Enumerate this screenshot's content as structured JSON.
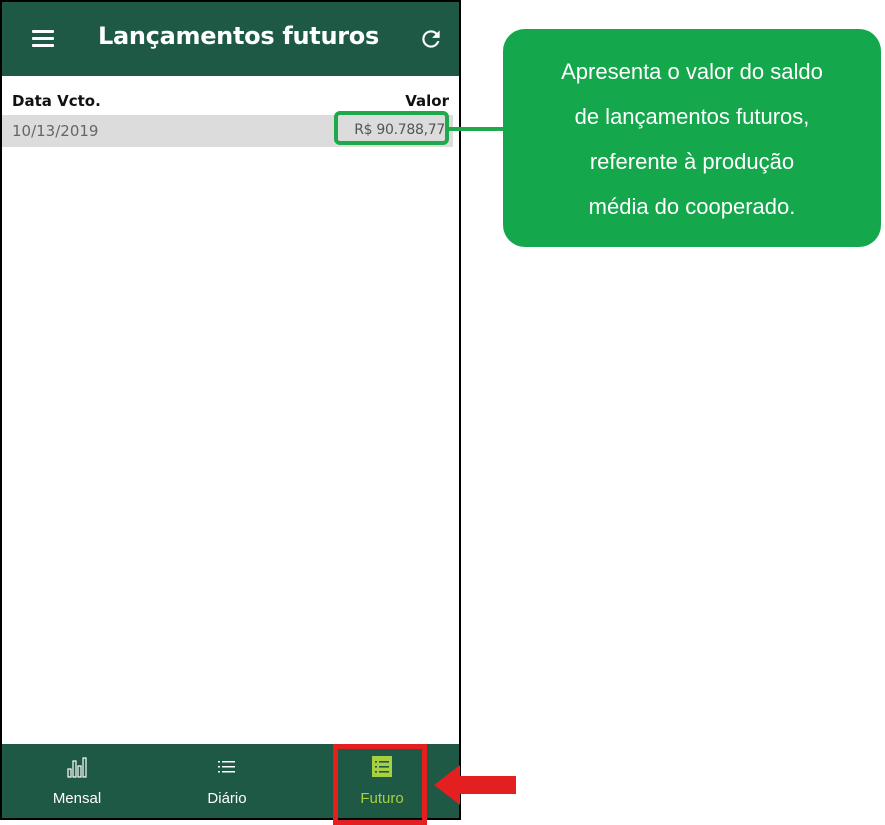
{
  "app_bar": {
    "title": "Lançamentos futuros",
    "menu_icon": "hamburger-menu-icon",
    "refresh_icon": "refresh-icon"
  },
  "table": {
    "headers": {
      "date": "Data Vcto.",
      "value": "Valor"
    },
    "rows": [
      {
        "date": "10/13/2019",
        "value": "R$ 90.788,77"
      }
    ]
  },
  "bottom_nav": {
    "items": [
      {
        "label": "Mensal",
        "icon": "bar-chart-icon",
        "active": false
      },
      {
        "label": "Diário",
        "icon": "list-icon",
        "active": false
      },
      {
        "label": "Futuro",
        "icon": "list-box-icon",
        "active": true
      }
    ]
  },
  "annotation": {
    "lines": [
      "Apresenta o valor do saldo",
      "de lançamentos futuros,",
      "referente à produção",
      "média do cooperado."
    ]
  },
  "colors": {
    "app_green": "#1e5945",
    "callout_green": "#15a74c",
    "highlight_green": "#1fa84c",
    "active_nav": "#a8cf3f",
    "red_marker": "#e41f1f"
  }
}
